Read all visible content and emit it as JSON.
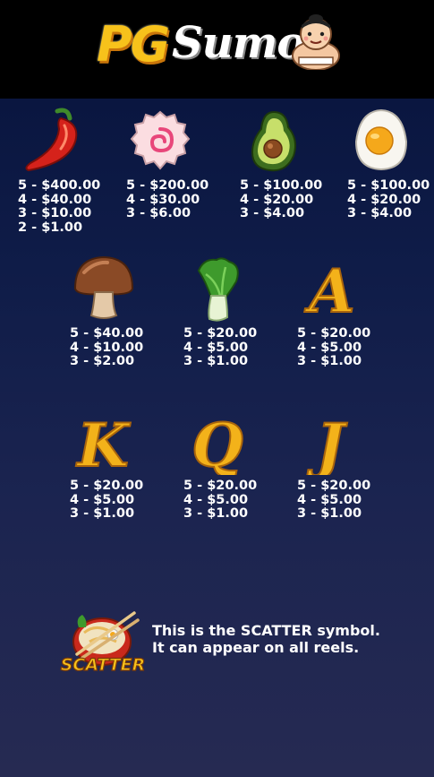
{
  "header": {
    "logo_pg": "PG",
    "logo_sumo": "Sumo"
  },
  "paytable": [
    {
      "symbol": "chili-pepper",
      "pays": [
        "5 - $400.00",
        "4 - $40.00",
        "3 - $10.00",
        "2 - $1.00"
      ]
    },
    {
      "symbol": "narutomaki",
      "pays": [
        "5 - $200.00",
        "4 - $30.00",
        "3 - $6.00"
      ]
    },
    {
      "symbol": "avocado",
      "pays": [
        "5 - $100.00",
        "4 - $20.00",
        "3 - $4.00"
      ]
    },
    {
      "symbol": "fried-egg",
      "pays": [
        "5 - $100.00",
        "4 - $20.00",
        "3 - $4.00"
      ]
    },
    {
      "symbol": "mushroom",
      "pays": [
        "5 - $40.00",
        "4 - $10.00",
        "3 - $2.00"
      ]
    },
    {
      "symbol": "bok-choy",
      "pays": [
        "5 - $20.00",
        "4 - $5.00",
        "3 - $1.00"
      ]
    },
    {
      "symbol": "letter-a",
      "letter": "A",
      "pays": [
        "5 - $20.00",
        "4 - $5.00",
        "3 - $1.00"
      ]
    },
    {
      "symbol": "letter-k",
      "letter": "K",
      "pays": [
        "5 - $20.00",
        "4 - $5.00",
        "3 - $1.00"
      ]
    },
    {
      "symbol": "letter-q",
      "letter": "Q",
      "pays": [
        "5 - $20.00",
        "4 - $5.00",
        "3 - $1.00"
      ]
    },
    {
      "symbol": "letter-j",
      "letter": "J",
      "pays": [
        "5 - $20.00",
        "4 - $5.00",
        "3 - $1.00"
      ]
    }
  ],
  "scatter": {
    "badge_label": "SCATTER",
    "line1": "This is the SCATTER symbol.",
    "line2": "It can appear on all reels."
  },
  "colors": {
    "gold": "#f3b21a",
    "background_top": "#07112e",
    "background_bottom": "#262a52"
  }
}
